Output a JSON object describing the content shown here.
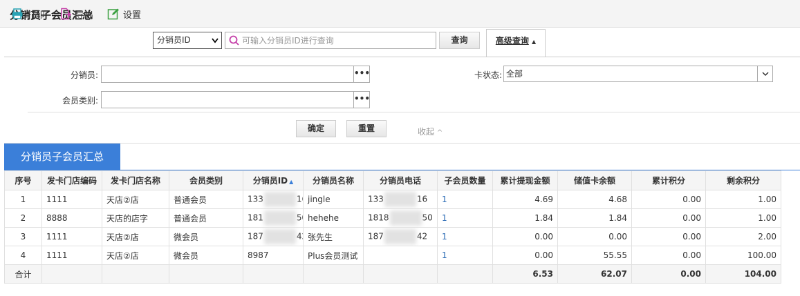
{
  "page": {
    "title": "分销员子会员汇总"
  },
  "toolbar": {
    "print_label": "打印",
    "export_label": "导出",
    "settings_label": "设置",
    "field_select_value": "分销员ID",
    "search_placeholder": "可输入分销员ID进行查询",
    "query_label": "查询",
    "advanced_label": "高级查询"
  },
  "advanced": {
    "distributor_label": "分销员:",
    "member_type_label": "会员类别:",
    "card_status_label": "卡状态:",
    "card_status_value": "全部",
    "dots": "•••",
    "confirm_label": "确定",
    "reset_label": "重置",
    "collapse_label": "收起"
  },
  "section": {
    "title": "分销员子会员汇总"
  },
  "table": {
    "columns": [
      "序号",
      "发卡门店编码",
      "发卡门店名称",
      "会员类别",
      "分销员ID",
      "分销员名称",
      "分销员电话",
      "子会员数量",
      "累计提现金额",
      "储值卡余额",
      "累计积分",
      "剩余积分"
    ],
    "rows": [
      {
        "idx": "1",
        "store_code": "1111",
        "store_name": "天店②店",
        "member_type": "普通会员",
        "dist_id_a": "133",
        "dist_id_b": "16",
        "dist_name": "jingle",
        "phone_a": "133",
        "phone_b": "16",
        "sub_count": "1",
        "withdraw": "4.69",
        "balance": "4.68",
        "points": "0.00",
        "remaining": "1.00"
      },
      {
        "idx": "2",
        "store_code": "8888",
        "store_name": "天店的店字",
        "member_type": "普通会员",
        "dist_id_a": "181",
        "dist_id_b": "50",
        "dist_name": "hehehe",
        "phone_a": "1818",
        "phone_b": "50",
        "sub_count": "1",
        "withdraw": "1.84",
        "balance": "1.84",
        "points": "0.00",
        "remaining": "1.00"
      },
      {
        "idx": "3",
        "store_code": "1111",
        "store_name": "天店②店",
        "member_type": "微会员",
        "dist_id_a": "187",
        "dist_id_b": "42",
        "dist_name": "张先生",
        "phone_a": "187",
        "phone_b": "42",
        "sub_count": "1",
        "withdraw": "0.00",
        "balance": "0.00",
        "points": "0.00",
        "remaining": "2.00"
      },
      {
        "idx": "4",
        "store_code": "1111",
        "store_name": "天店②店",
        "member_type": "微会员",
        "dist_id_a": "8987",
        "dist_id_b": "",
        "dist_name": "Plus会员测试",
        "phone_a": "",
        "phone_b": "",
        "sub_count": "1",
        "withdraw": "0.00",
        "balance": "55.55",
        "points": "0.00",
        "remaining": "100.00"
      }
    ],
    "total": {
      "label": "合计",
      "withdraw": "6.53",
      "balance": "62.07",
      "points": "0.00",
      "remaining": "104.00"
    }
  },
  "colors": {
    "accent": "#3b7fd9",
    "link": "#2a6ab5"
  }
}
